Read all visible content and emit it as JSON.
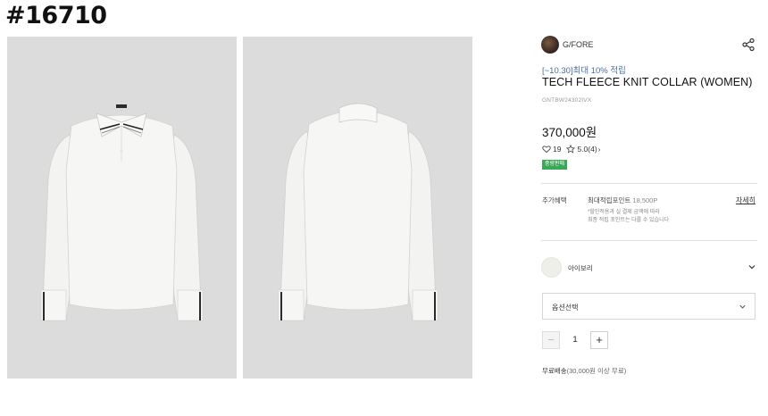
{
  "page_id": "#16710",
  "brand": {
    "name": "G/FORE",
    "logo_icon": "brand-logo-avatar"
  },
  "product": {
    "promo": "[~10.30]최대 10% 적립",
    "title": "TECH FLEECE KNIT COLLAR (WOMEN)",
    "code": "GNTBW24302IVX",
    "price": "370,000원",
    "likes": "19",
    "rating": "5.0(4)",
    "rating_chevron": "›",
    "badge": "중량판매"
  },
  "benefit": {
    "label": "추가혜택",
    "max_points_label": "최대적립포인트",
    "max_points": "18,500P",
    "detail_link": "자세히",
    "note_line1": "*할인적용과 실 결제 금액에 따라",
    "note_line2": "최종 적립 포인트는 다를 수 있습니다"
  },
  "color": {
    "name": "아이보리",
    "swatch_hex": "#efefea"
  },
  "option_select": {
    "placeholder": "옵션선택"
  },
  "quantity": {
    "value": "1",
    "minus": "−",
    "plus": "+"
  },
  "shipping": {
    "label": "무료배송",
    "condition": "(30,000원 이상 무료)"
  },
  "icons": {
    "share": "share-icon",
    "heart": "heart-icon",
    "star": "star-icon",
    "chevron": "chevron-down-icon"
  },
  "colors": {
    "accent_blue": "#4a6fa5",
    "badge_green": "#3aa857",
    "photo_bg": "#dcdcdc"
  }
}
